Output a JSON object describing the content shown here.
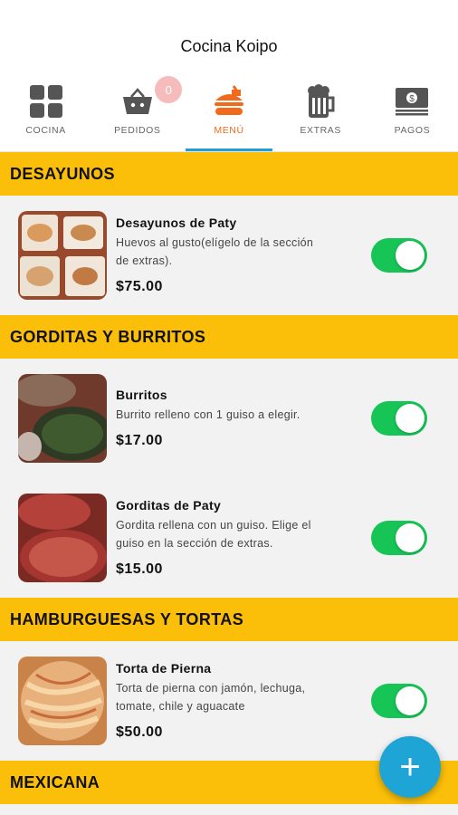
{
  "app": {
    "title": "Cocina Koipo"
  },
  "tabs": [
    {
      "label": "COCINA",
      "icon": "grid-icon"
    },
    {
      "label": "PEDIDOS",
      "icon": "basket-icon",
      "badge": "0"
    },
    {
      "label": "MENÚ",
      "icon": "burger-icon",
      "active": true
    },
    {
      "label": "EXTRAS",
      "icon": "beer-icon"
    },
    {
      "label": "PAGOS",
      "icon": "money-icon"
    }
  ],
  "sections": [
    {
      "title": "DESAYUNOS",
      "items": [
        {
          "name": "Desayunos de Paty",
          "desc": "Huevos al gusto(elígelo de la sección de extras).",
          "price": "$75.00",
          "enabled": true
        }
      ]
    },
    {
      "title": "GORDITAS Y BURRITOS",
      "items": [
        {
          "name": "Burritos",
          "desc": "Burrito relleno con 1 guiso a elegir.",
          "price": "$17.00",
          "enabled": true
        },
        {
          "name": "Gorditas de Paty",
          "desc": "Gordita rellena con un guiso. Elige el guiso en la sección de extras.",
          "price": "$15.00",
          "enabled": true
        }
      ]
    },
    {
      "title": "HAMBURGUESAS Y TORTAS",
      "items": [
        {
          "name": "Torta de Pierna",
          "desc": "Torta de pierna con jamón, lechuga, tomate, chile y aguacate",
          "price": "$50.00",
          "enabled": true
        }
      ]
    },
    {
      "title": "MEXICANA",
      "items": []
    }
  ],
  "fab": {
    "label": "+"
  },
  "colors": {
    "accent": "#1e9fd6",
    "section": "#fbbf0a",
    "toggle_on": "#16c556",
    "active_tab": "#f26a1b"
  }
}
